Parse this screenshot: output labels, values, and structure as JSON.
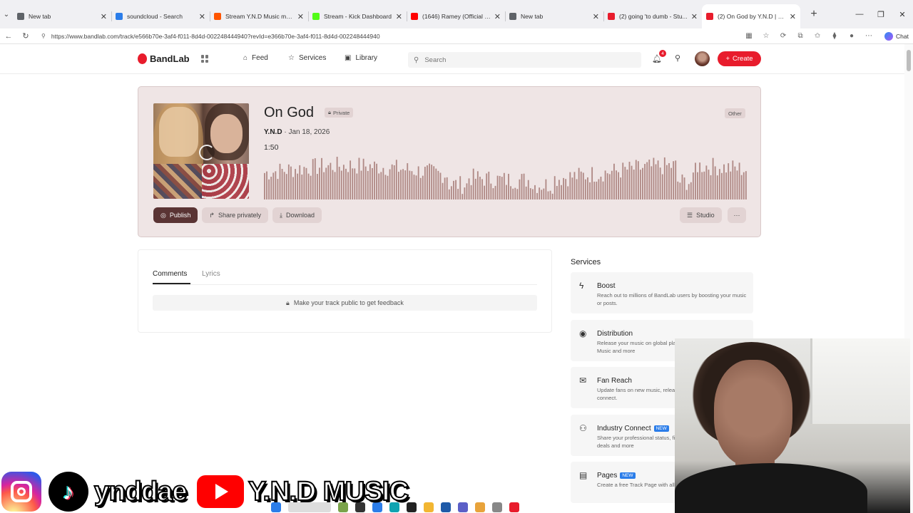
{
  "browser": {
    "tabs": [
      {
        "title": "New tab",
        "color": "#5f6368"
      },
      {
        "title": "soundcloud - Search",
        "color": "#2b7de9"
      },
      {
        "title": "Stream Y.N.D Music music | ...",
        "color": "#ff5500"
      },
      {
        "title": "Stream - Kick Dashboard",
        "color": "#53fc18"
      },
      {
        "title": "(1646) Ramey (Official Music...",
        "color": "#ff0000"
      },
      {
        "title": "New tab",
        "color": "#5f6368"
      },
      {
        "title": "(2) going 'to dumb - Stu...",
        "color": "#e81c2c"
      },
      {
        "title": "(2) On God by Y.N.D | BandL...",
        "color": "#e81c2c"
      }
    ],
    "active_tab_index": 7,
    "url": "https://www.bandlab.com/track/e566b70e-3af4-f011-8d4d-002248444940?revId=e366b70e-3af4-f011-8d4d-002248444940",
    "chat_label": "Chat"
  },
  "header": {
    "logo": "BandLab",
    "nav": [
      {
        "label": "Feed",
        "icon": "home-icon"
      },
      {
        "label": "Services",
        "icon": "star-icon"
      },
      {
        "label": "Library",
        "icon": "library-icon"
      }
    ],
    "search_placeholder": "Search",
    "notification_count": "4",
    "create_label": "Create",
    "accent": "#e81c2c"
  },
  "track": {
    "title": "On God",
    "visibility": "Private",
    "genre": "Other",
    "artist": "Y.N.D",
    "date": "Jan 18, 2026",
    "duration": "1:50",
    "actions": {
      "publish": "Publish",
      "share": "Share privately",
      "download": "Download",
      "studio": "Studio"
    }
  },
  "comments": {
    "tabs": [
      "Comments",
      "Lyrics"
    ],
    "active_tab": "Comments",
    "empty_message": "Make your track public to get feedback"
  },
  "services": {
    "title": "Services",
    "items": [
      {
        "name": "Boost",
        "icon": "lightning-icon",
        "desc": "Reach out to millions of BandLab users by boosting your music or posts.",
        "new": false
      },
      {
        "name": "Distribution",
        "icon": "distribution-icon",
        "desc": "Release your music on global platforms like Spotify, Apple Music and more",
        "new": false
      },
      {
        "name": "Fan Reach",
        "icon": "mail-icon",
        "desc": "Update fans on new music, releases or simply reach out to connect.",
        "new": false
      },
      {
        "name": "Industry Connect",
        "icon": "people-icon",
        "desc": "Share your professional status, find representation, record deals and more",
        "new": true
      },
      {
        "name": "Pages",
        "icon": "pages-icon",
        "desc": "Create a free Track Page with all your links in one place",
        "new": true
      }
    ],
    "new_label": "NEW"
  },
  "overlay": {
    "tiktok_handle": "ynddae",
    "youtube_name": "Y.N.D MUSIC"
  }
}
